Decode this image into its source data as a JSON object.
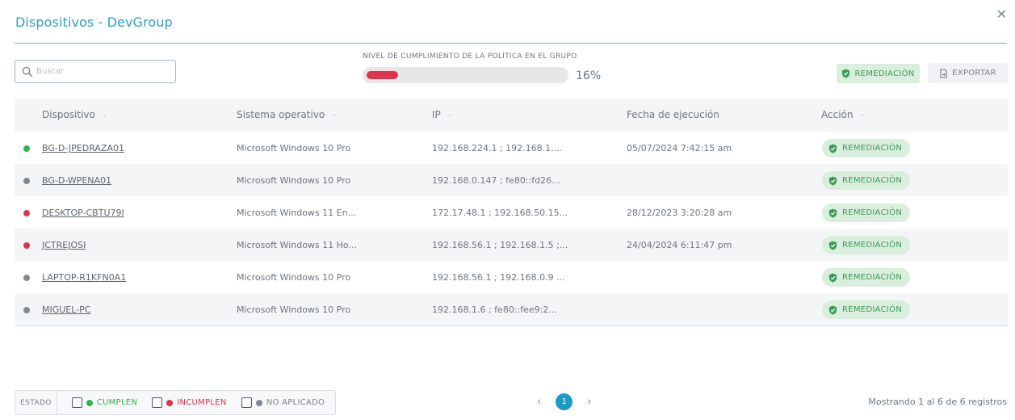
{
  "dialog": {
    "title": "Dispositivos - DevGroup",
    "close_symbol": "✕"
  },
  "search": {
    "placeholder": "Buscar"
  },
  "compliance": {
    "label": "NIVEL DE CUMPLIMIENTO DE LA POLÍTICA EN EL GRUPO",
    "value_text": "16%",
    "value": 0.16,
    "color": "#e0344e"
  },
  "toolbar": {
    "remediation_label": "REMEDIACIÓN",
    "export_label": "EXPORTAR"
  },
  "table": {
    "columns": [
      "Dispositivo",
      "Sistema operativo",
      "IP",
      "Fecha de ejecución",
      "Acción"
    ],
    "rows": [
      {
        "status": "cumple",
        "device": "BG-D-JPEDRAZA01",
        "os": "Microsoft Windows 10 Pro",
        "ip": "192.168.224.1 ; 192.168.1....",
        "date": "05/07/2024 7:42:15 am",
        "action": "REMEDIACIÓN"
      },
      {
        "status": "no_aplicado",
        "device": "BG-D-WPENA01",
        "os": "Microsoft Windows 10 Pro",
        "ip": "192.168.0.147 ; fe80::fd26...",
        "date": "",
        "action": "REMEDIACIÓN"
      },
      {
        "status": "incumple",
        "device": "DESKTOP-CBTU79I",
        "os": "Microsoft Windows 11 En...",
        "ip": "172.17.48.1 ; 192.168.50.15...",
        "date": "28/12/2023 3:20:28 am",
        "action": "REMEDIACIÓN"
      },
      {
        "status": "incumple",
        "device": "JCTREJOSI",
        "os": "Microsoft Windows 11 Ho...",
        "ip": "192.168.56.1 ; 192.168.1.5 ;...",
        "date": "24/04/2024 6:11:47 pm",
        "action": "REMEDIACIÓN"
      },
      {
        "status": "no_aplicado",
        "device": "LAPTOP-R1KFN0A1",
        "os": "Microsoft Windows 10 Pro",
        "ip": "192.168.56.1 ; 192.168.0.9 ...",
        "date": "",
        "action": "REMEDIACIÓN"
      },
      {
        "status": "no_aplicado",
        "device": "MIGUEL-PC",
        "os": "Microsoft Windows 10 Pro",
        "ip": "192.168.1.6 ; fe80::fee9:2...",
        "date": "",
        "action": "REMEDIACIÓN"
      }
    ]
  },
  "status_colors": {
    "cumple": "#2fb34a",
    "incumple": "#e0344e",
    "no_aplicado": "#7d8894"
  },
  "legend": {
    "label": "ESTADO",
    "items": [
      {
        "key": "cumple",
        "label": "CUMPLEN",
        "color": "#2fb34a"
      },
      {
        "key": "incumple",
        "label": "INCUMPLEN",
        "color": "#e0344e"
      },
      {
        "key": "no_aplicado",
        "label": "NO APLICADO",
        "color": "#7d8894"
      }
    ]
  },
  "pagination": {
    "current_page": "1",
    "prev_symbol": "‹",
    "next_symbol": "›"
  },
  "records_text": "Mostrando 1 al 6 de 6 registros",
  "icons": {
    "search": "search-icon",
    "close": "close-icon",
    "shield": "shield-check-icon",
    "export": "export-icon",
    "sort": "chevron-down-icon"
  }
}
